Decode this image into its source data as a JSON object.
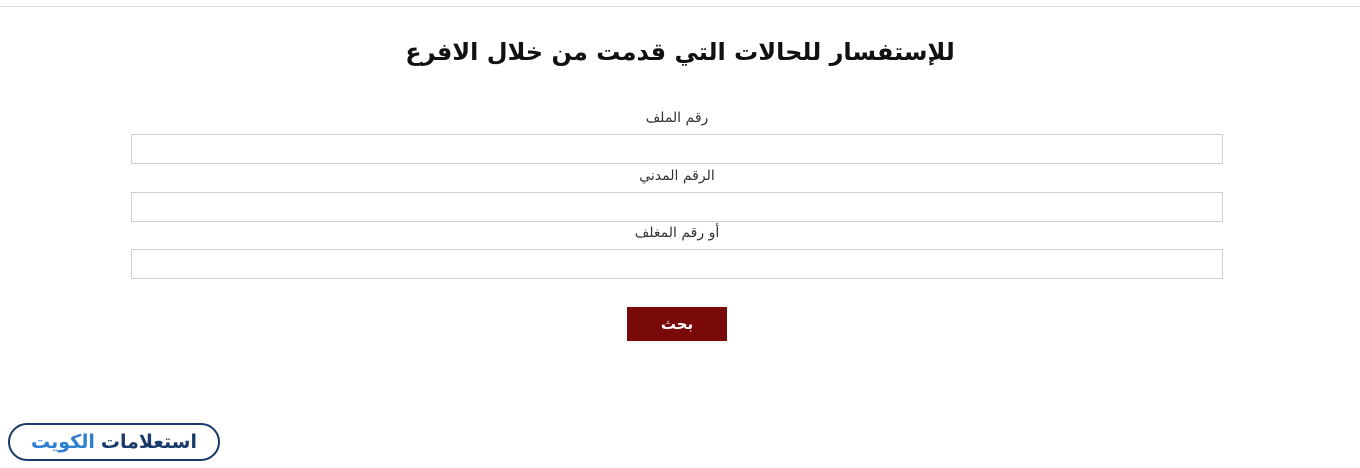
{
  "page": {
    "title": "للإستفسار للحالات التي قدمت من خلال الافرع"
  },
  "form": {
    "fields": [
      {
        "label": "رقم الملف",
        "value": "",
        "placeholder": ""
      },
      {
        "label": "الرقم المدني",
        "value": "",
        "placeholder": ""
      },
      {
        "label": "أو رقم المغلف",
        "value": "",
        "placeholder": ""
      }
    ],
    "submit_label": "بحث"
  },
  "watermark": {
    "word1": "استعلامات",
    "word2": "الكويت"
  },
  "colors": {
    "button_bg": "#7a0a0a",
    "button_text": "#ffffff",
    "watermark_dark": "#173a6a",
    "watermark_light": "#2f7fd0"
  }
}
